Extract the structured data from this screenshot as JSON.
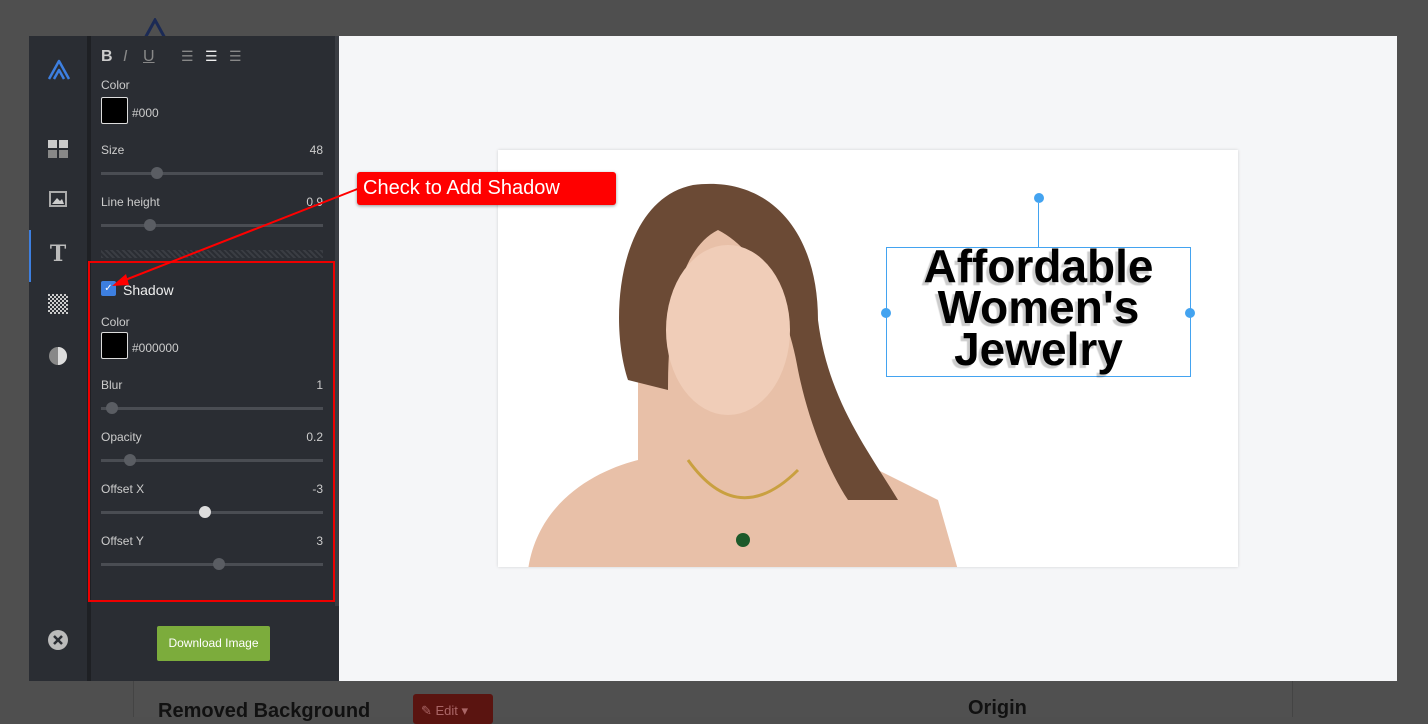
{
  "background_page": {
    "section_title": "Removed Background",
    "edit_label": "Edit",
    "origin_title": "Origin"
  },
  "editor": {
    "rail": [
      {
        "icon": "logo-icon"
      },
      {
        "icon": "layout-grid-icon"
      },
      {
        "icon": "image-icon"
      },
      {
        "icon": "text-icon",
        "active": true
      },
      {
        "icon": "background-pattern-icon"
      },
      {
        "icon": "contrast-icon"
      },
      {
        "icon": "close-icon"
      }
    ],
    "format": {
      "bold": "B",
      "italic": "I",
      "underline": "U",
      "align": "center"
    },
    "text_color": {
      "label": "Color",
      "value": "#000"
    },
    "size": {
      "label": "Size",
      "value": "48",
      "slider_fraction": 0.25
    },
    "line_height": {
      "label": "Line height",
      "value": "0.9",
      "slider_fraction": 0.22
    },
    "shadow": {
      "enabled": true,
      "label": "Shadow",
      "color": {
        "label": "Color",
        "value": "#000000"
      },
      "blur": {
        "label": "Blur",
        "value": "1",
        "slider_fraction": 0.05
      },
      "opacity": {
        "label": "Opacity",
        "value": "0.2",
        "slider_fraction": 0.13
      },
      "offset_x": {
        "label": "Offset X",
        "value": "-3",
        "slider_fraction": 0.47
      },
      "offset_y": {
        "label": "Offset Y",
        "value": "3",
        "slider_fraction": 0.53
      }
    },
    "download_label": "Download Image"
  },
  "canvas": {
    "headline": [
      "Affordable",
      "Women's",
      "Jewelry"
    ]
  },
  "annotation": {
    "callout": "Check to Add Shadow",
    "color": "#ff0000"
  }
}
